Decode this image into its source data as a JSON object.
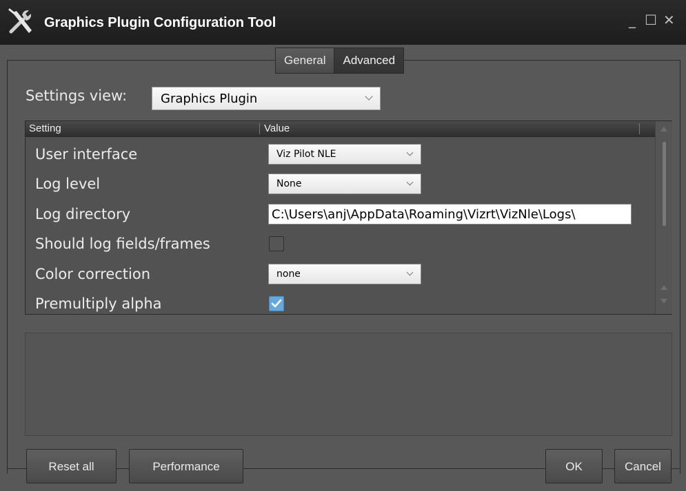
{
  "window": {
    "title": "Graphics Plugin Configuration Tool",
    "minimize_glyph": "_",
    "maximize_glyph": "☐",
    "close_glyph": "✕"
  },
  "tabs": [
    {
      "label": "General",
      "active": false
    },
    {
      "label": "Advanced",
      "active": true
    }
  ],
  "settings_view": {
    "label": "Settings view:",
    "value": "Graphics Plugin"
  },
  "grid": {
    "columns": [
      "Setting",
      "Value"
    ],
    "rows": [
      {
        "label": "User interface",
        "type": "combo",
        "value": "Viz Pilot NLE"
      },
      {
        "label": "Log level",
        "type": "combo",
        "value": "None"
      },
      {
        "label": "Log directory",
        "type": "text",
        "value": "C:\\Users\\anj\\AppData\\Roaming\\Vizrt\\VizNle\\Logs\\"
      },
      {
        "label": "Should log fields/frames",
        "type": "checkbox",
        "checked": false
      },
      {
        "label": "Color correction",
        "type": "combo",
        "value": "none"
      },
      {
        "label": "Premultiply alpha",
        "type": "checkbox",
        "checked": true
      }
    ]
  },
  "buttons": {
    "reset_all": "Reset all",
    "performance": "Performance",
    "ok": "OK",
    "cancel": "Cancel"
  },
  "colors": {
    "titlebar": "#1f1f1f",
    "background": "#585858",
    "checkbox_checked": "#65a9dd"
  },
  "icons": {
    "app": "tools-icon",
    "chevron": "chevron-down-icon",
    "check": "checkmark-icon"
  }
}
